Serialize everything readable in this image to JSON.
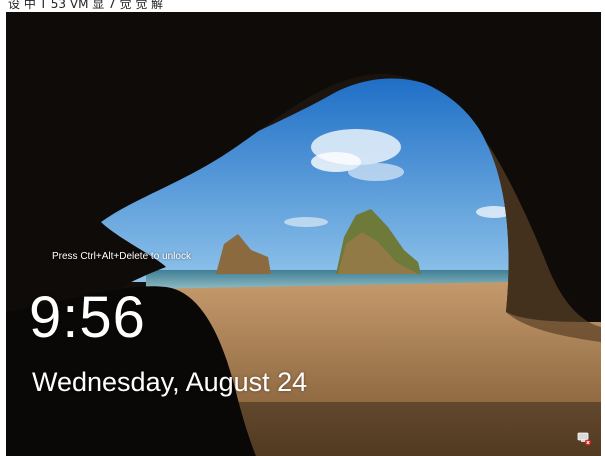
{
  "header_caption": "设 中 T 53 VM 显 7 觉 觉 解",
  "lock_screen": {
    "unlock_hint": "Press Ctrl+Alt+Delete to unlock",
    "time": "9:56",
    "date": "Wednesday, August 24"
  },
  "status_icons": {
    "network": "network-disconnected-icon"
  },
  "colors": {
    "sky": "#2f7fd0",
    "sea": "#6aa6b8",
    "sand": "#b8875a",
    "cave": "#0d0b09",
    "text": "#ffffff"
  }
}
